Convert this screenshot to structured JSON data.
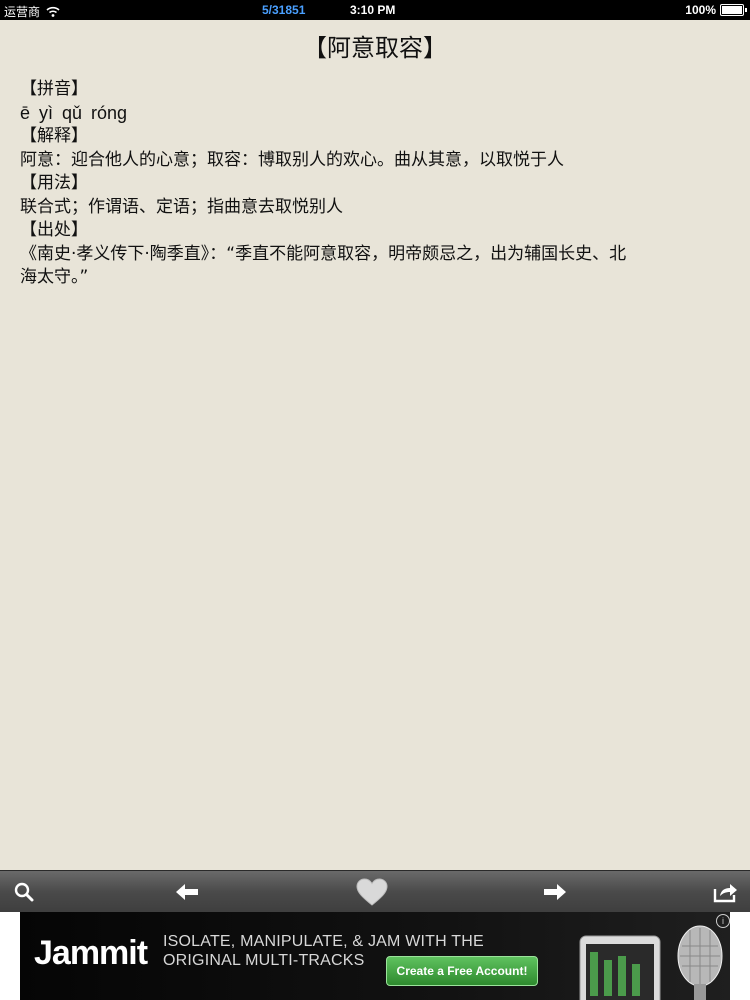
{
  "status_bar": {
    "carrier": "运营商",
    "progress": "5/31851",
    "time": "3:10 PM",
    "battery_percent": "100%",
    "battery_level": 1.0
  },
  "entry": {
    "title": "【阿意取容】",
    "pinyin_header": "【拼音】",
    "pinyin": "ē yì qǔ róng",
    "meaning_header": "【解释】",
    "meaning": "阿意：迎合他人的心意；取容：博取别人的欢心。曲从其意，以取悦于人",
    "usage_header": "【用法】",
    "usage": "联合式；作谓语、定语；指曲意去取悦别人",
    "source_header": "【出处】",
    "source_line1": "《南史·孝义传下·陶季直》：“季直不能阿意取容，明帝颇忌之，出为辅国长史、北",
    "source_line2": "海太守。”"
  },
  "toolbar": {
    "icons": [
      "search-icon",
      "back-arrow-icon",
      "heart-icon",
      "forward-arrow-icon",
      "share-icon"
    ]
  },
  "ad": {
    "logo": "Jammit",
    "tagline_line1": "ISOLATE, MANIPULATE, & JAM WITH THE",
    "tagline_line2": "ORIGINAL MULTI-TRACKS",
    "cta": "Create a Free Account!",
    "info": "i"
  }
}
